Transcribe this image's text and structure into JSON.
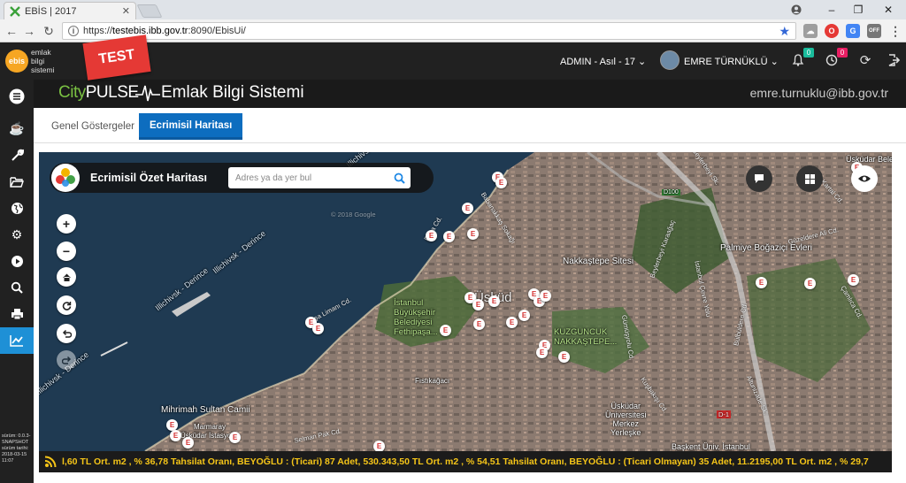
{
  "browser": {
    "tab_title": "EBİS | 2017",
    "url_scheme": "https://",
    "url_host": "testebis.ibb.gov.tr",
    "url_rest": ":8090/EbisUi/"
  },
  "header": {
    "logo_badge": "ebis",
    "logo_line1": "emlak",
    "logo_line2": "bilgi",
    "logo_line3": "sistemi",
    "test_badge": "TEST",
    "org": "ADMIN - Asıl - 17",
    "user_name": "EMRE TÜRNÜKLÜ",
    "notif_count": "0",
    "task_count": "0"
  },
  "banner": {
    "brand_city": "City",
    "brand_pulse": "PULSE",
    "app_title": "Emlak Bilgi Sistemi",
    "email": "emre.turnuklu@ibb.gov.tr"
  },
  "tabs": [
    {
      "label": "Genel Göstergeler"
    },
    {
      "label": "Ecrimisil Haritası"
    }
  ],
  "map": {
    "panel_title": "Ecrimisil Özet Haritası",
    "search_placeholder": "Adres ya da yer bul",
    "marker_letter": "E",
    "labels": {
      "nakkastepe": "Nakkaştepe Sitesi",
      "palmiye": "Palmiye Boğaziçi Evleri",
      "ibb_1": "İstanbul",
      "ibb_2": "Büyükşehir",
      "ibb_3": "Belediyesi",
      "ibb_4": "Fethipaşa...",
      "kuzguncuk_1": "KUZGUNCUK",
      "kuzguncuk_2": "NAKKAŞTEPE...",
      "mihrimah": "Mihrimah Sultan Camii",
      "uskudar_uni_1": "Üsküdar",
      "uskudar_uni_2": "Üniversitesi",
      "uskudar_uni_3": "Merkez",
      "uskudar_uni_4": "Yerleşke",
      "fistikagaci": "Fıstıkağacı",
      "marmaray": "Marmaray",
      "uskudar_istasyonu": "Üsküdar İstasyonu",
      "uskudar_bel": "Üsküdar Bele",
      "baskent": "Başkent Üniv. İstanbul",
      "d100": "D100",
      "route_1": "Illichivsk - Derince",
      "route_2": "Illichivsk - Derince",
      "route_3": "Illichivsk - Derince",
      "route_4": "Illichivsk",
      "uskudar_partial": "Üsküd",
      "street_pasa_limani": "Paşa Limanı Cd.",
      "street_babanakkas": "Babanakkaş Sokağı",
      "street_gumusyolu": "Gümüşyolu Cd.",
      "street_beylerbeyi": "Beylerbeyi Karaağaç",
      "street_cevre": "İstanbul Çevre Yolu",
      "street_guzeldere": "Güzeldere Ali Cd.",
      "street_camlica": "Çamlıca Cd.",
      "street_bulbuldere": "Bülbüldere Cd.",
      "street_kusbakisi": "Kuşbakışı Cd.",
      "street_selman": "Selman Pak Cd.",
      "street_beylerbeyi_sk": "Beylerbeyi Sk.",
      "street_pasa_cd": "Paşa Cd.",
      "street_altunizade": "Altunizade Sk.",
      "street_kartal": "Kartal Cd.",
      "street_google": "© 2018 Google",
      "street_d1": "D-1"
    }
  },
  "ticker": {
    "text": "l,60 TL Ort. m2 , % 36,78 Tahsilat Oranı,  BEYOĞLU : (Ticari) 87 Adet, 530.343,50 TL Ort. m2 , % 54,51 Tahsilat Oranı,  BEYOĞLU : (Ticari Olmayan) 35 Adet, 11.2195,00 TL Ort. m2 , % 29,7"
  },
  "sidebar": {
    "version": "sürüm: 0.0.3-SNAPSHOT sürüm tarihi: 2018-03-15 11:07"
  },
  "colors": {
    "accent": "#1e90d6",
    "tab_active": "#0d6dbf",
    "ticker_text": "#f5c518",
    "marker_letter": "#d32f2f",
    "test_badge": "#e53935"
  }
}
